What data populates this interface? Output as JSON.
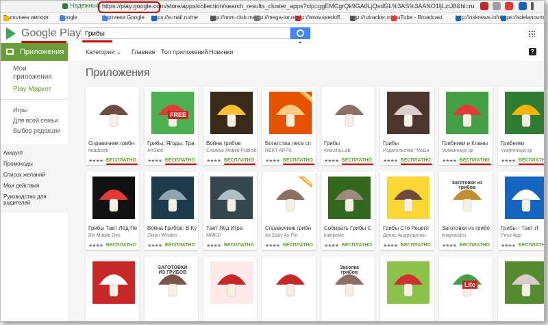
{
  "browser": {
    "secure_label": "Надежный",
    "url": "https://play.google.com/store/apps/collection/search_results_cluster_apps?clp=ggEMCgrQk9GA0LjQsdGL%3AS%3AANO1ljLztJ8&hl=ru",
    "bookmarks": [
      {
        "label": "Выполнен импорт",
        "color": "#f4b400"
      },
      {
        "label": "Google",
        "color": "#4285f4"
      },
      {
        "label": "Картинки Google",
        "color": "#4285f4"
      },
      {
        "label": "https://e.mail.ru/me",
        "color": "#1565c0"
      },
      {
        "label": "http://nnm-club.me/",
        "color": "#555555"
      },
      {
        "label": "http://mega-tor.org/",
        "color": "#777777"
      },
      {
        "label": "http://www.seedoff.",
        "color": "#c62828"
      },
      {
        "label": "http://rutracker.org/",
        "color": "#555555"
      },
      {
        "label": "YouTube - Broadcast",
        "color": "#e53935"
      },
      {
        "label": "http://nsknews.info/",
        "color": "#1565c0"
      },
      {
        "label": "https://sdelanouml",
        "color": "#1565c0"
      }
    ]
  },
  "header": {
    "logo": "Google Play",
    "search_value": "Грибы"
  },
  "subnav": {
    "apps_tab": "Приложения",
    "categories": "Категории",
    "links": [
      "Главная",
      "Топ приложений",
      "Новинки"
    ],
    "help": "?"
  },
  "sidebar": {
    "my_apps": "Мои приложения",
    "store": "Play Маркет",
    "links": [
      "Игры",
      "Для всей семьи",
      "Выбор редакции"
    ],
    "account_links": [
      "Аккаунт",
      "Промокоды",
      "Список желаний",
      "Мои действия",
      "Руководство для родителей"
    ]
  },
  "main": {
    "title": "Приложения",
    "price_label": "БЕСПЛАТНО",
    "apps": [
      {
        "name": "Справочник грибн",
        "dev": "headcorp",
        "bg": "#ffffff",
        "fg": "#6d4c41"
      },
      {
        "name": "Грибы, Ягоды, Тра",
        "dev": "ArtSeld",
        "bg": "#4caf50",
        "fg": "#e53935",
        "badge": "FREE"
      },
      {
        "name": "Война грибов",
        "dev": "Creative Mobile Publish",
        "bg": "#3a2a1a",
        "fg": "#fbc02d"
      },
      {
        "name": "Богатства леса сп",
        "dev": "REKT APPS",
        "bg": "#e65100",
        "fg": "#ffcc80",
        "corner": "FREE"
      },
      {
        "name": "Грибы",
        "dev": "Kiwizilla Lab",
        "bg": "#ffffff",
        "fg": "#8d6e63"
      },
      {
        "name": "Грибы",
        "dev": "Издательство \"МоБи",
        "bg": "#4e342e",
        "fg": "#d7ccc8"
      },
      {
        "name": "Грибники и Кланы",
        "dev": "Vselennaya igr",
        "bg": "#43a047",
        "fg": "#e53935"
      },
      {
        "name": "Грибники",
        "dev": "Vselennaya igr",
        "bg": "#2e7d32",
        "fg": "#ffb300"
      },
      {
        "name": "Грибы Тает Лёд Пе",
        "dev": "RK Mobile Dev",
        "bg": "#111111",
        "fg": "#e53935"
      },
      {
        "name": "Война Грибов: В Ку",
        "dev": "Zillion Whales",
        "bg": "#1b3a4b",
        "fg": "#90a4ae"
      },
      {
        "name": "Тает Лёд Игра",
        "dev": "MMKD",
        "bg": "#37474f",
        "fg": "#b0bec5"
      },
      {
        "name": "Справочник грибн",
        "dev": "As Easy As Pie",
        "bg": "#ffffff",
        "fg": "#8d6e63",
        "corner": "АБАР"
      },
      {
        "name": "Собирать Грибы С",
        "dev": "kukipekle",
        "bg": "#33691e",
        "fg": "#a1887f"
      },
      {
        "name": "Грибы Сто Рецепт",
        "dev": "Денис Андрущенко",
        "bg": "#fdd835",
        "fg": "#6d4c41"
      },
      {
        "name": "Заготовки из грибо",
        "dev": "knigivasilisi",
        "bg": "#ffffff",
        "fg": "#bf8f30",
        "text": "Заготовки из грибов"
      },
      {
        "name": "Грибы - Тает Л",
        "dev": "Pinut App",
        "bg": "#1565c0",
        "fg": "#ffffff"
      },
      {
        "name": "",
        "dev": "",
        "bg": "#c62828",
        "fg": "#ffffff"
      },
      {
        "name": "",
        "dev": "",
        "bg": "#ffffff",
        "fg": "#795548",
        "text": "ЗАГОТОВКИ ИЗ ГРИБОВ"
      },
      {
        "name": "",
        "dev": "",
        "bg": "#fbe9e7",
        "fg": "#c62828"
      },
      {
        "name": "",
        "dev": "",
        "bg": "#ffffff",
        "fg": "#c62828"
      },
      {
        "name": "",
        "dev": "",
        "bg": "#ffffff",
        "fg": "#8d6e63",
        "text": "Засолка грибов"
      },
      {
        "name": "",
        "dev": "",
        "bg": "#8bc34a",
        "fg": "#d32f2f"
      },
      {
        "name": "",
        "dev": "",
        "bg": "#ffffff",
        "fg": "#43a047",
        "badge": "Lite"
      },
      {
        "name": "",
        "dev": "",
        "bg": "#558b2f",
        "fg": "#d7ccc8"
      }
    ]
  }
}
